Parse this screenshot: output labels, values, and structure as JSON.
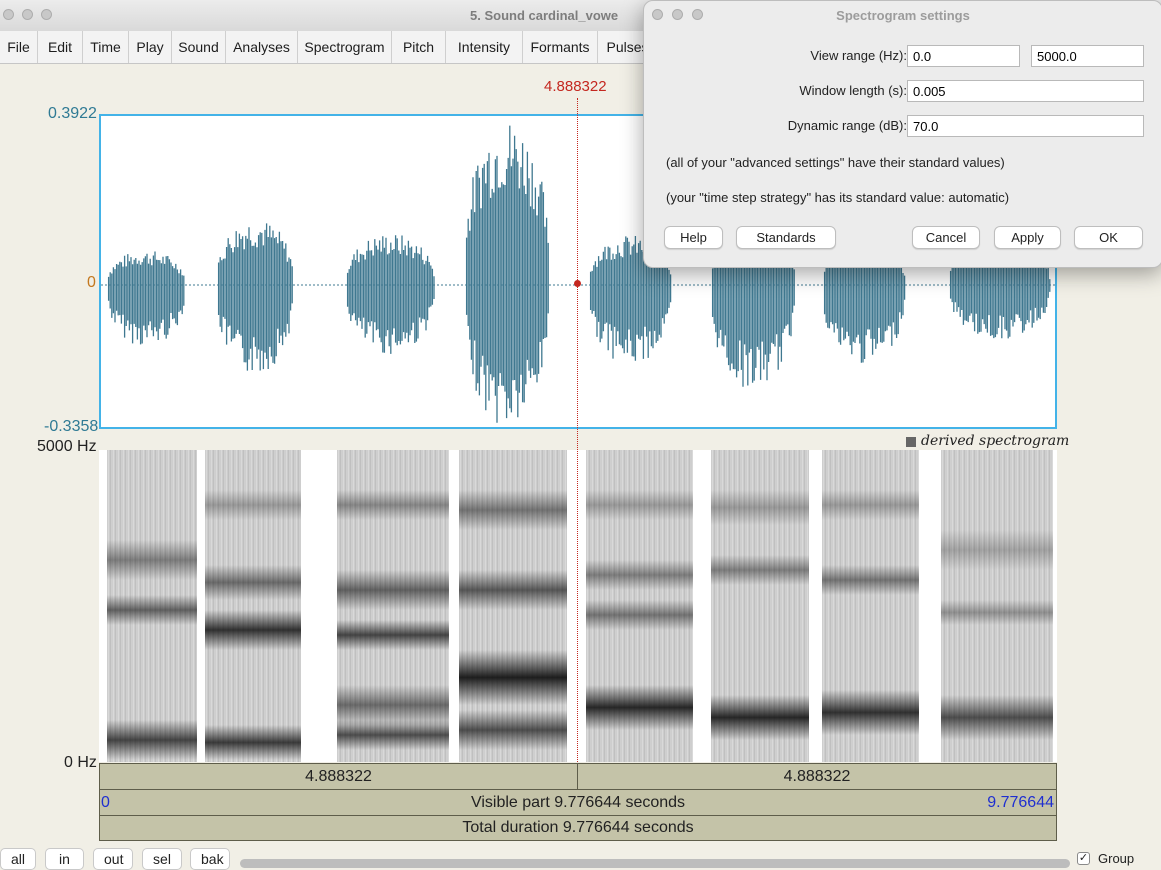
{
  "window": {
    "title": "5. Sound cardinal_vowe"
  },
  "menu": [
    "File",
    "Edit",
    "Time",
    "Play",
    "Sound",
    "Analyses",
    "Spectrogram",
    "Pitch",
    "Intensity",
    "Formants",
    "Pulses"
  ],
  "sound": {
    "ymax": "0.3922",
    "zero": "0",
    "ymin": "-0.3358",
    "cursor_time": "4.888322"
  },
  "spectrogram": {
    "fmax": "5000 Hz",
    "fmin": "0 Hz",
    "legend": "derived spectrogram"
  },
  "timebars": {
    "left_part": "4.888322",
    "right_part": "4.888322",
    "visible_start": "0",
    "visible_label": "Visible part 9.776644 seconds",
    "visible_end": "9.776644",
    "total_label": "Total duration 9.776644 seconds"
  },
  "zoom_buttons": [
    "all",
    "in",
    "out",
    "sel",
    "bak"
  ],
  "group": {
    "label": "Group",
    "checked": true
  },
  "dialog": {
    "title": "Spectrogram settings",
    "view_range_label": "View range (Hz):",
    "view_range_from": "0.0",
    "view_range_to": "5000.0",
    "window_length_label": "Window length (s):",
    "window_length": "0.005",
    "dynamic_range_label": "Dynamic range (dB):",
    "dynamic_range": "70.0",
    "note_advanced": "(all of your \"advanced settings\" have their standard values)",
    "note_timestep": "(your \"time step strategy\" has its standard value: automatic)",
    "buttons": {
      "help": "Help",
      "standards": "Standards",
      "cancel": "Cancel",
      "apply": "Apply",
      "ok": "OK"
    }
  },
  "colors": {
    "waveform": "#3f7890",
    "cursor": "#c4271f",
    "selection_border": "#43b3e8",
    "time_bar": "#c4c3a8",
    "axis_label": "#2f7a94",
    "blue_time": "#1f2fd0"
  }
}
